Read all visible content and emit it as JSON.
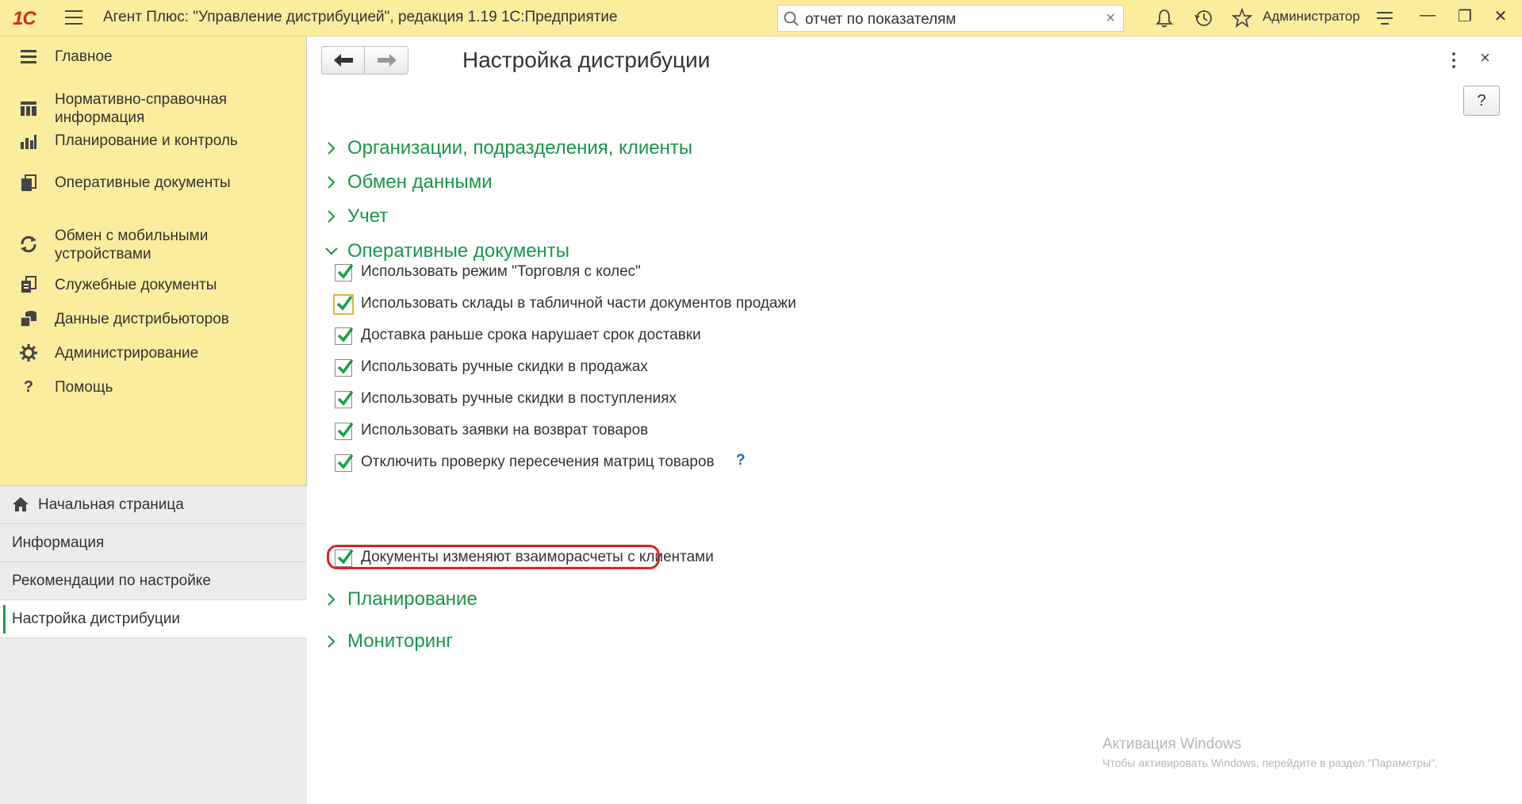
{
  "titlebar": {
    "logo": "1С",
    "app_title": "Агент Плюс: \"Управление дистрибуцией\", редакция 1.19 1С:Предприятие",
    "search_value": "отчет по показателям",
    "user": "Администратор",
    "accent_color": "#fbed9e"
  },
  "sidebar": {
    "items": [
      {
        "label": "Главное",
        "icon": "menu-lines-icon"
      },
      {
        "label": "Нормативно-справочная\nинформация",
        "icon": "catalog-icon"
      },
      {
        "label": "Планирование и контроль",
        "icon": "bar-chart-icon"
      },
      {
        "label": "Оперативные документы",
        "icon": "documents-icon"
      },
      {
        "label": "Обмен с мобильными\nустройствами",
        "icon": "sync-icon"
      },
      {
        "label": "Служебные документы",
        "icon": "service-docs-icon"
      },
      {
        "label": "Данные дистрибьюторов",
        "icon": "distributor-data-icon"
      },
      {
        "label": "Администрирование",
        "icon": "gear-icon"
      },
      {
        "label": "Помощь",
        "icon": "question-icon"
      }
    ],
    "nav": [
      {
        "label": "Начальная страница",
        "icon": "home-icon"
      },
      {
        "label": "Информация"
      },
      {
        "label": "Рекомендации по настройке"
      },
      {
        "label": "Настройка дистрибуции",
        "active": true
      }
    ]
  },
  "main": {
    "title": "Настройка дистрибуции",
    "help_label": "?",
    "groups": [
      {
        "label": "Организации, подразделения, клиенты",
        "expanded": false
      },
      {
        "label": "Обмен данными",
        "expanded": false
      },
      {
        "label": "Учет",
        "expanded": false
      },
      {
        "label": "Оперативные документы",
        "expanded": true
      },
      {
        "label": "Планирование",
        "expanded": false
      },
      {
        "label": "Мониторинг",
        "expanded": false
      }
    ],
    "checkboxes": [
      {
        "label": "Использовать режим \"Торговля с колес\"",
        "checked": true
      },
      {
        "label": "Использовать склады в табличной части документов продажи",
        "checked": true,
        "focused": true
      },
      {
        "label": "Доставка раньше срока нарушает срок доставки",
        "checked": true
      },
      {
        "label": "Использовать ручные скидки в продажах",
        "checked": true
      },
      {
        "label": "Использовать ручные скидки в поступлениях",
        "checked": true
      },
      {
        "label": "Использовать заявки на возврат товаров",
        "checked": true
      },
      {
        "label": "Отключить проверку пересечения матриц товаров",
        "checked": true,
        "help": "?"
      },
      {
        "label": "Документы изменяют взаиморасчеты с клиентами",
        "checked": true,
        "highlighted": true
      }
    ],
    "group_color": "#17964a",
    "highlight_color": "#e02020"
  },
  "watermark": {
    "line1": "Активация Windows",
    "line2": "Чтобы активировать Windows, перейдите в раздел \"Параметры\"."
  }
}
